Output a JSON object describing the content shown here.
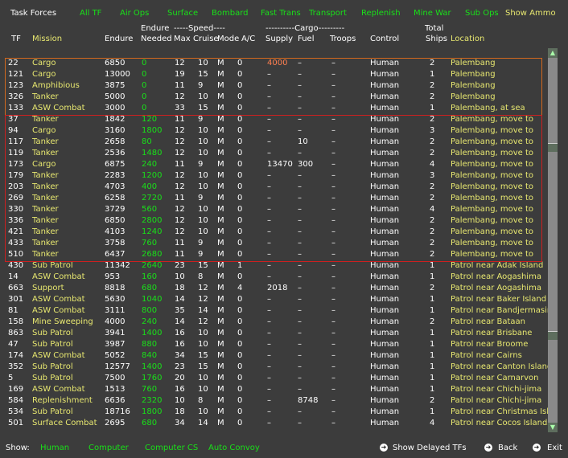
{
  "top": {
    "title": "Task Forces",
    "filters": [
      "All TF",
      "Air Ops",
      "Surface",
      "Bombard",
      "Fast Trans",
      "Transport",
      "Replenish",
      "Mine War",
      "Sub Ops"
    ],
    "show_ammo": "Show Ammo"
  },
  "headers": {
    "tf": "TF",
    "mission": "Mission",
    "endure": "Endure",
    "endure_top": "Endure",
    "needed": "Needed",
    "speed": "-----Speed----",
    "max": "Max",
    "cruise": "Cruise",
    "mode": "Mode",
    "ac": "A/C",
    "cargo": "----------Cargo---------",
    "supply": "Supply",
    "fuel": "Fuel",
    "troops": "Troops",
    "control": "Control",
    "total": "Total",
    "ships": "Ships",
    "location": "Location"
  },
  "rows": [
    {
      "tf": "22",
      "mission": "Cargo",
      "endure": "6850",
      "needed": "0",
      "max": "12",
      "cruise": "10",
      "mode": "M",
      "ac": "0",
      "supply": "4000",
      "fuel": "–",
      "troops": "–",
      "control": "Human",
      "ships": "2",
      "loc": "Palembang"
    },
    {
      "tf": "121",
      "mission": "Cargo",
      "endure": "13000",
      "needed": "0",
      "max": "19",
      "cruise": "15",
      "mode": "M",
      "ac": "0",
      "supply": "–",
      "fuel": "–",
      "troops": "–",
      "control": "Human",
      "ships": "1",
      "loc": "Palembang"
    },
    {
      "tf": "123",
      "mission": "Amphibious",
      "endure": "3875",
      "needed": "0",
      "max": "11",
      "cruise": "9",
      "mode": "M",
      "ac": "0",
      "supply": "–",
      "fuel": "–",
      "troops": "–",
      "control": "Human",
      "ships": "2",
      "loc": "Palembang"
    },
    {
      "tf": "326",
      "mission": "Tanker",
      "endure": "5000",
      "needed": "0",
      "max": "12",
      "cruise": "10",
      "mode": "M",
      "ac": "0",
      "supply": "–",
      "fuel": "–",
      "troops": "–",
      "control": "Human",
      "ships": "2",
      "loc": "Palembang"
    },
    {
      "tf": "133",
      "mission": "ASW Combat",
      "endure": "3000",
      "needed": "0",
      "max": "33",
      "cruise": "15",
      "mode": "M",
      "ac": "0",
      "supply": "–",
      "fuel": "–",
      "troops": "–",
      "control": "Human",
      "ships": "1",
      "loc": "Palembang, at sea"
    },
    {
      "tf": "37",
      "mission": "Tanker",
      "endure": "1842",
      "needed": "120",
      "max": "11",
      "cruise": "9",
      "mode": "M",
      "ac": "0",
      "supply": "–",
      "fuel": "–",
      "troops": "–",
      "control": "Human",
      "ships": "2",
      "loc": "Palembang, move to"
    },
    {
      "tf": "94",
      "mission": "Cargo",
      "endure": "3160",
      "needed": "1800",
      "max": "12",
      "cruise": "10",
      "mode": "M",
      "ac": "0",
      "supply": "–",
      "fuel": "–",
      "troops": "–",
      "control": "Human",
      "ships": "3",
      "loc": "Palembang, move to"
    },
    {
      "tf": "117",
      "mission": "Tanker",
      "endure": "2658",
      "needed": "80",
      "max": "12",
      "cruise": "10",
      "mode": "M",
      "ac": "0",
      "supply": "–",
      "fuel": "10",
      "troops": "–",
      "control": "Human",
      "ships": "2",
      "loc": "Palembang, move to"
    },
    {
      "tf": "119",
      "mission": "Tanker",
      "endure": "2536",
      "needed": "1480",
      "max": "12",
      "cruise": "10",
      "mode": "M",
      "ac": "0",
      "supply": "–",
      "fuel": "–",
      "troops": "–",
      "control": "Human",
      "ships": "2",
      "loc": "Palembang, move to"
    },
    {
      "tf": "173",
      "mission": "Cargo",
      "endure": "6875",
      "needed": "240",
      "max": "11",
      "cruise": "9",
      "mode": "M",
      "ac": "0",
      "supply": "13470",
      "fuel": "300",
      "troops": "–",
      "control": "Human",
      "ships": "4",
      "loc": "Palembang, move to"
    },
    {
      "tf": "179",
      "mission": "Tanker",
      "endure": "2283",
      "needed": "1200",
      "max": "12",
      "cruise": "10",
      "mode": "M",
      "ac": "0",
      "supply": "–",
      "fuel": "–",
      "troops": "–",
      "control": "Human",
      "ships": "3",
      "loc": "Palembang, move to"
    },
    {
      "tf": "203",
      "mission": "Tanker",
      "endure": "4703",
      "needed": "400",
      "max": "12",
      "cruise": "10",
      "mode": "M",
      "ac": "0",
      "supply": "–",
      "fuel": "–",
      "troops": "–",
      "control": "Human",
      "ships": "2",
      "loc": "Palembang, move to"
    },
    {
      "tf": "269",
      "mission": "Tanker",
      "endure": "6258",
      "needed": "2720",
      "max": "11",
      "cruise": "9",
      "mode": "M",
      "ac": "0",
      "supply": "–",
      "fuel": "–",
      "troops": "–",
      "control": "Human",
      "ships": "2",
      "loc": "Palembang, move to"
    },
    {
      "tf": "330",
      "mission": "Tanker",
      "endure": "3729",
      "needed": "560",
      "max": "12",
      "cruise": "10",
      "mode": "M",
      "ac": "0",
      "supply": "–",
      "fuel": "–",
      "troops": "–",
      "control": "Human",
      "ships": "4",
      "loc": "Palembang, move to"
    },
    {
      "tf": "336",
      "mission": "Tanker",
      "endure": "6850",
      "needed": "2800",
      "max": "12",
      "cruise": "10",
      "mode": "M",
      "ac": "0",
      "supply": "–",
      "fuel": "–",
      "troops": "–",
      "control": "Human",
      "ships": "2",
      "loc": "Palembang, move to"
    },
    {
      "tf": "421",
      "mission": "Tanker",
      "endure": "4103",
      "needed": "1240",
      "max": "12",
      "cruise": "10",
      "mode": "M",
      "ac": "0",
      "supply": "–",
      "fuel": "–",
      "troops": "–",
      "control": "Human",
      "ships": "2",
      "loc": "Palembang, move to"
    },
    {
      "tf": "433",
      "mission": "Tanker",
      "endure": "3758",
      "needed": "760",
      "max": "11",
      "cruise": "9",
      "mode": "M",
      "ac": "0",
      "supply": "–",
      "fuel": "–",
      "troops": "–",
      "control": "Human",
      "ships": "2",
      "loc": "Palembang, move to"
    },
    {
      "tf": "510",
      "mission": "Tanker",
      "endure": "6437",
      "needed": "2680",
      "max": "11",
      "cruise": "9",
      "mode": "M",
      "ac": "0",
      "supply": "–",
      "fuel": "–",
      "troops": "–",
      "control": "Human",
      "ships": "2",
      "loc": "Palembang, move to"
    },
    {
      "tf": "430",
      "mission": "Sub Patrol",
      "endure": "11342",
      "needed": "2640",
      "max": "23",
      "cruise": "15",
      "mode": "M",
      "ac": "1",
      "supply": "–",
      "fuel": "–",
      "troops": "–",
      "control": "Human",
      "ships": "1",
      "loc": "Patrol near Adak Island"
    },
    {
      "tf": "14",
      "mission": "ASW Combat",
      "endure": "953",
      "needed": "160",
      "max": "10",
      "cruise": "8",
      "mode": "M",
      "ac": "0",
      "supply": "–",
      "fuel": "–",
      "troops": "–",
      "control": "Human",
      "ships": "1",
      "loc": "Patrol near Aogashima"
    },
    {
      "tf": "663",
      "mission": "Support",
      "endure": "8818",
      "needed": "680",
      "max": "18",
      "cruise": "12",
      "mode": "M",
      "ac": "4",
      "supply": "2018",
      "fuel": "–",
      "troops": "–",
      "control": "Human",
      "ships": "2",
      "loc": "Patrol near Aogashima"
    },
    {
      "tf": "301",
      "mission": "ASW Combat",
      "endure": "5630",
      "needed": "1040",
      "max": "14",
      "cruise": "12",
      "mode": "M",
      "ac": "0",
      "supply": "–",
      "fuel": "–",
      "troops": "–",
      "control": "Human",
      "ships": "1",
      "loc": "Patrol near Baker Island"
    },
    {
      "tf": "81",
      "mission": "ASW Combat",
      "endure": "3111",
      "needed": "800",
      "max": "35",
      "cruise": "14",
      "mode": "M",
      "ac": "0",
      "supply": "–",
      "fuel": "–",
      "troops": "–",
      "control": "Human",
      "ships": "1",
      "loc": "Patrol near Bandjermasin"
    },
    {
      "tf": "158",
      "mission": "Mine Sweeping",
      "endure": "4000",
      "needed": "240",
      "max": "14",
      "cruise": "12",
      "mode": "M",
      "ac": "0",
      "supply": "–",
      "fuel": "–",
      "troops": "–",
      "control": "Human",
      "ships": "2",
      "loc": "Patrol near Bataan"
    },
    {
      "tf": "863",
      "mission": "Sub Patrol",
      "endure": "3941",
      "needed": "1400",
      "max": "16",
      "cruise": "10",
      "mode": "M",
      "ac": "0",
      "supply": "–",
      "fuel": "–",
      "troops": "–",
      "control": "Human",
      "ships": "1",
      "loc": "Patrol near Brisbane"
    },
    {
      "tf": "47",
      "mission": "Sub Patrol",
      "endure": "3987",
      "needed": "880",
      "max": "16",
      "cruise": "10",
      "mode": "M",
      "ac": "0",
      "supply": "–",
      "fuel": "–",
      "troops": "–",
      "control": "Human",
      "ships": "1",
      "loc": "Patrol near Broome"
    },
    {
      "tf": "174",
      "mission": "ASW Combat",
      "endure": "5052",
      "needed": "840",
      "max": "34",
      "cruise": "15",
      "mode": "M",
      "ac": "0",
      "supply": "–",
      "fuel": "–",
      "troops": "–",
      "control": "Human",
      "ships": "1",
      "loc": "Patrol near Cairns"
    },
    {
      "tf": "352",
      "mission": "Sub Patrol",
      "endure": "12577",
      "needed": "1400",
      "max": "23",
      "cruise": "15",
      "mode": "M",
      "ac": "0",
      "supply": "–",
      "fuel": "–",
      "troops": "–",
      "control": "Human",
      "ships": "1",
      "loc": "Patrol near Canton Island"
    },
    {
      "tf": "5",
      "mission": "Sub Patrol",
      "endure": "7500",
      "needed": "1760",
      "max": "20",
      "cruise": "10",
      "mode": "M",
      "ac": "0",
      "supply": "–",
      "fuel": "–",
      "troops": "–",
      "control": "Human",
      "ships": "1",
      "loc": "Patrol near Carnarvon"
    },
    {
      "tf": "169",
      "mission": "ASW Combat",
      "endure": "1513",
      "needed": "760",
      "max": "16",
      "cruise": "10",
      "mode": "M",
      "ac": "0",
      "supply": "–",
      "fuel": "–",
      "troops": "–",
      "control": "Human",
      "ships": "1",
      "loc": "Patrol near Chichi-jima"
    },
    {
      "tf": "584",
      "mission": "Replenishment",
      "endure": "6636",
      "needed": "2320",
      "max": "10",
      "cruise": "8",
      "mode": "M",
      "ac": "0",
      "supply": "–",
      "fuel": "8748",
      "troops": "–",
      "control": "Human",
      "ships": "2",
      "loc": "Patrol near Chichi-jima"
    },
    {
      "tf": "534",
      "mission": "Sub Patrol",
      "endure": "18716",
      "needed": "1800",
      "max": "18",
      "cruise": "10",
      "mode": "M",
      "ac": "0",
      "supply": "–",
      "fuel": "–",
      "troops": "–",
      "control": "Human",
      "ships": "1",
      "loc": "Patrol near Christmas Isla"
    },
    {
      "tf": "501",
      "mission": "Surface Combat",
      "endure": "2695",
      "needed": "680",
      "max": "34",
      "cruise": "14",
      "mode": "M",
      "ac": "0",
      "supply": "–",
      "fuel": "–",
      "troops": "–",
      "control": "Human",
      "ships": "4",
      "loc": "Patrol near Cocos Islands"
    }
  ],
  "bottom": {
    "show_label": "Show:",
    "options": [
      "Human",
      "Computer",
      "Computer CS",
      "Auto Convoy"
    ],
    "delayed": "Show Delayed TFs",
    "back": "Back",
    "exit": "Exit"
  }
}
